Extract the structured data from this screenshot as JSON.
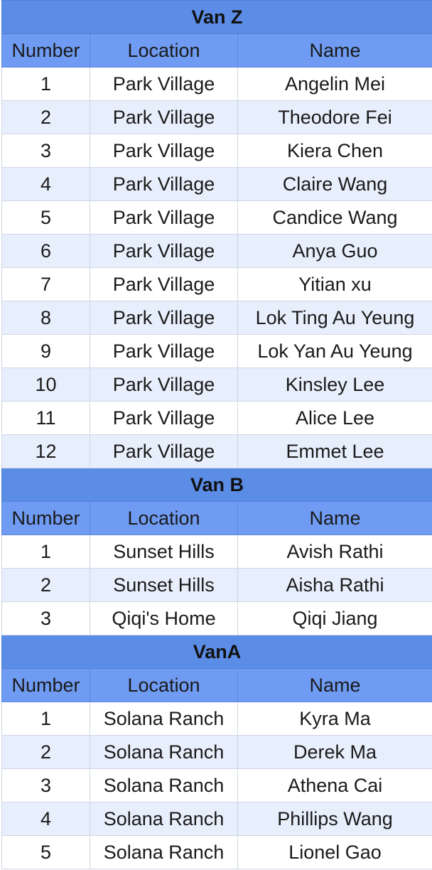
{
  "columns": [
    "Number",
    "Location",
    "Name"
  ],
  "colors": {
    "title_bg": "#5b8de6",
    "header_bg": "#6f9bf2",
    "band_bg": "#e8effc",
    "row_bg": "#ffffff"
  },
  "vans": [
    {
      "title": "Van Z",
      "rows": [
        {
          "number": "1",
          "location": "Park Village",
          "name": "Angelin Mei"
        },
        {
          "number": "2",
          "location": "Park Village",
          "name": "Theodore Fei"
        },
        {
          "number": "3",
          "location": "Park Village",
          "name": "Kiera Chen"
        },
        {
          "number": "4",
          "location": "Park Village",
          "name": "Claire Wang"
        },
        {
          "number": "5",
          "location": "Park Village",
          "name": "Candice Wang"
        },
        {
          "number": "6",
          "location": "Park Village",
          "name": "Anya Guo"
        },
        {
          "number": "7",
          "location": "Park Village",
          "name": "Yitian xu"
        },
        {
          "number": "8",
          "location": "Park Village",
          "name": "Lok Ting Au Yeung"
        },
        {
          "number": "9",
          "location": "Park Village",
          "name": "Lok Yan Au Yeung"
        },
        {
          "number": "10",
          "location": "Park Village",
          "name": "Kinsley Lee"
        },
        {
          "number": "11",
          "location": "Park Village",
          "name": "Alice Lee"
        },
        {
          "number": "12",
          "location": "Park Village",
          "name": "Emmet Lee"
        }
      ]
    },
    {
      "title": "Van B",
      "rows": [
        {
          "number": "1",
          "location": "Sunset Hills",
          "name": "Avish Rathi"
        },
        {
          "number": "2",
          "location": "Sunset Hills",
          "name": "Aisha Rathi"
        },
        {
          "number": "3",
          "location": "Qiqi's Home",
          "name": "Qiqi Jiang"
        }
      ]
    },
    {
      "title": "VanA",
      "rows": [
        {
          "number": "1",
          "location": "Solana Ranch",
          "name": "Kyra Ma"
        },
        {
          "number": "2",
          "location": "Solana Ranch",
          "name": "Derek Ma"
        },
        {
          "number": "3",
          "location": "Solana Ranch",
          "name": "Athena Cai"
        },
        {
          "number": "4",
          "location": "Solana Ranch",
          "name": "Phillips Wang"
        },
        {
          "number": "5",
          "location": "Solana Ranch",
          "name": "Lionel Gao"
        }
      ]
    }
  ]
}
